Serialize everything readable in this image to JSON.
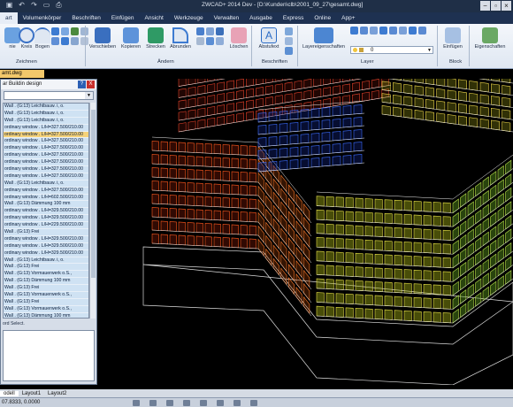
{
  "app": {
    "title": "ZWCAD+ 2014 Dev - [D:\\Kunden\\clb\\2001_09_27\\gesamt.dwg]",
    "quick_access": [
      "save-icon",
      "undo-icon",
      "redo-icon",
      "open-icon",
      "print-icon"
    ],
    "window_controls": [
      "−",
      "▫",
      "×"
    ]
  },
  "menu": {
    "items": [
      "art",
      "Volumenkörper",
      "Beschriften",
      "Einfügen",
      "Ansicht",
      "Werkzeuge",
      "Verwalten",
      "Ausgabe",
      "Express",
      "Online",
      "App+"
    ],
    "active_index": 0
  },
  "ribbon": {
    "draw_buttons": [
      "nie",
      "Kreis",
      "Bogen"
    ],
    "modify_buttons": [
      "Verschieben",
      "Kopieren",
      "Strecken",
      "Abrunden",
      "Löschen"
    ],
    "annotation_button": "Abstufext",
    "layer_button": "Layereigenschaften",
    "layer_combo_value": "0",
    "block_button": "Einfügen",
    "properties_button": "Eigenschaften",
    "panels": [
      "Zeichnen",
      "Ändern",
      "Beschriften",
      "Layer",
      "Block"
    ],
    "colors": {
      "accent": "#2a6bc5",
      "panel_bg": "#e7edf6"
    }
  },
  "file_tab": "amt.dwg",
  "left_panel": {
    "title": "ar Buildin design",
    "help": "?",
    "close": "X",
    "rows": [
      "Wall  .  (G:13) Leichtbauw. i, o.",
      "Wall  .  (G:13) Leichtbauw. i, o.",
      "Wall  .  (G:13) Leichtbauw. i, o.",
      "ordinary window  .  L/H=327.500/210.00",
      "ordinary window  .  L/H=327.500/210.00",
      "ordinary window  .  L/H=327.500/210.00",
      "ordinary window  .  L/H=327.500/210.00",
      "ordinary window  .  L/H=327.500/210.00",
      "ordinary window  .  L/H=327.500/210.00",
      "ordinary window  .  L/H=327.500/210.00",
      "ordinary window  .  L/H=327.500/210.00",
      "Wall  .  (G:13) Leichtbauw. i, o.",
      "ordinary window  .  L/H=327.500/210.00",
      "ordinary window  .  L/H=602.500/210.00",
      "Wall  .  (G:13) Dämmung 100 mm",
      "ordinary window  .  L/H=329.500/210.00",
      "ordinary window  .  L/H=329.500/210.00",
      "ordinary window  .  L/H=229.500/210.00",
      "Wall  .  (G:13) Frei",
      "ordinary window  .  L/H=329.500/210.00",
      "ordinary window  .  L/H=329.500/210.00",
      "ordinary window  .  L/H=329.500/210.00",
      "Wall  .  (G:13) Leichtbauw. i, o.",
      "Wall  .  (G:13) Frei",
      "Wall  .  (G:13) Vormauerwerk o.S.,",
      "Wall  .  (G:13) Dämmung 100 mm",
      "Wall  .  (G:13) Frei",
      "Wall  .  (G:13) Vormauerwerk o.S.,",
      "Wall  .  (G:13) Frei",
      "Wall  .  (G:13) Vormauerwerk o.S.,",
      "Wall  .  (G:13) Dämmung 100 mm"
    ],
    "selected_index": 4,
    "status": "ord Select."
  },
  "layout_tabs": [
    "odell",
    "Layout1",
    "Layout2"
  ],
  "active_layout": 0,
  "status_bar": {
    "coords": "07.8333, 0.0000"
  }
}
